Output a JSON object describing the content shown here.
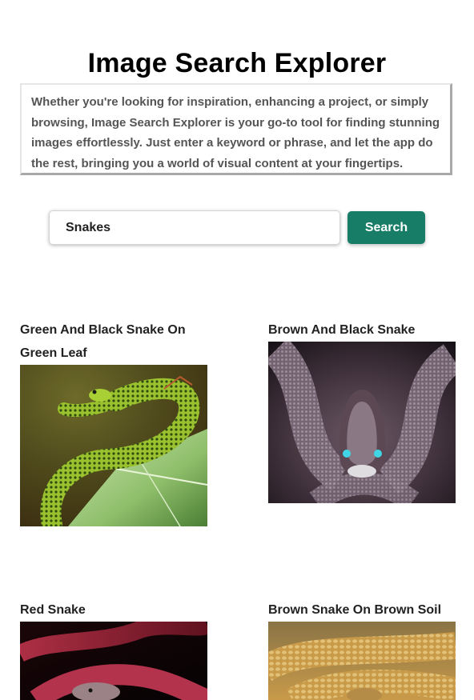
{
  "app": {
    "title": "Image Search Explorer",
    "description": "Whether you're looking for inspiration, enhancing a project, or simply browsing, Image Search Explorer is your go-to tool for finding stunning images effortlessly. Just enter a keyword or phrase, and let the app do the rest, bringing you a world of visual content at your fingertips."
  },
  "search": {
    "value": "Snakes",
    "button_label": "Search"
  },
  "accent_color": "#177d66",
  "results": [
    {
      "title": "Green And Black Snake On Green Leaf"
    },
    {
      "title": "Brown And Black Snake"
    },
    {
      "title": "Red Snake"
    },
    {
      "title": "Brown Snake On Brown Soil"
    }
  ]
}
